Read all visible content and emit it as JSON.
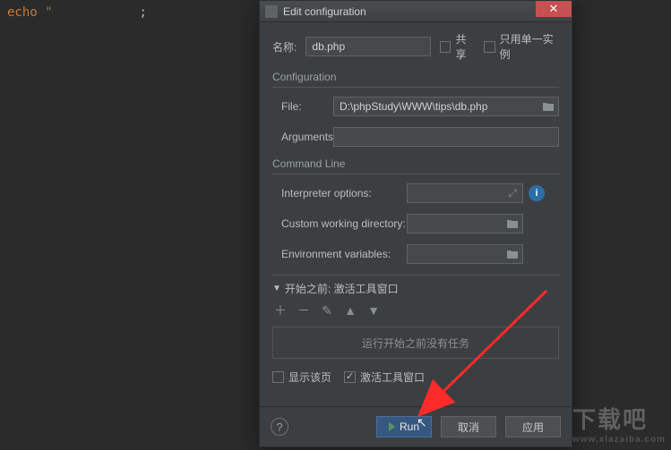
{
  "editor": {
    "keyword": "echo",
    "string_open": "\"",
    "semicolon": ";"
  },
  "dialog": {
    "title": "Edit configuration",
    "name_label": "名称:",
    "name_value": "db.php",
    "share_label": "共享",
    "single_instance_label": "只用单一实例",
    "config_section": "Configuration",
    "file_label": "File:",
    "file_value": "D:\\phpStudy\\WWW\\tips\\db.php",
    "arguments_label": "Arguments:",
    "arguments_value": "",
    "cmdline_section": "Command Line",
    "interpreter_options_label": "Interpreter options:",
    "interpreter_options_value": "",
    "cwd_label": "Custom working directory:",
    "cwd_value": "",
    "env_label": "Environment variables:",
    "env_value": "",
    "before_launch_header": "开始之前: 激活工具窗口",
    "no_tasks": "运行开始之前没有任务",
    "show_page_label": "显示该页",
    "activate_tool_label": "激活工具窗口",
    "run_label": "Run",
    "cancel_label": "取消",
    "apply_label": "应用"
  },
  "watermark": {
    "main": "下载吧",
    "sub": "www.xiazaiba.com"
  }
}
